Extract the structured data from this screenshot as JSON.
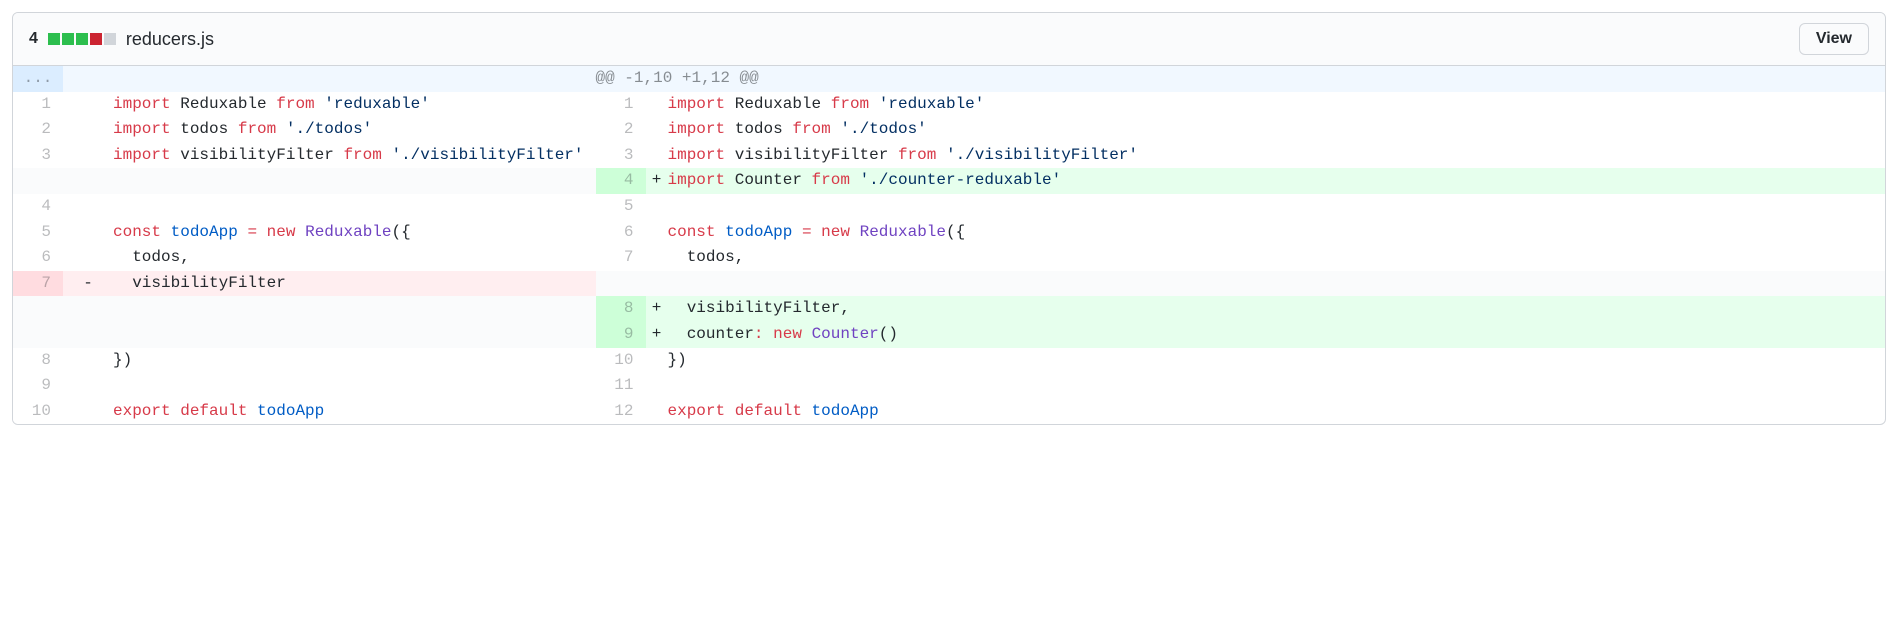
{
  "header": {
    "change_count": "4",
    "filename": "reducers.js",
    "view_label": "View",
    "diffstat": [
      "add",
      "add",
      "add",
      "del",
      "neutral"
    ]
  },
  "hunk": {
    "dots": "...",
    "text": "@@ -1,10 +1,12 @@"
  },
  "rows": [
    {
      "ln_l": "1",
      "ln_r": "1",
      "type": "ctx",
      "left": [
        {
          "t": "import",
          "c": "k"
        },
        {
          "t": " ",
          "c": ""
        },
        {
          "t": "Reduxable",
          "c": "nx"
        },
        {
          "t": " ",
          "c": ""
        },
        {
          "t": "from",
          "c": "k"
        },
        {
          "t": " ",
          "c": ""
        },
        {
          "t": "'reduxable'",
          "c": "s"
        }
      ],
      "right": [
        {
          "t": "import",
          "c": "k"
        },
        {
          "t": " ",
          "c": ""
        },
        {
          "t": "Reduxable",
          "c": "nx"
        },
        {
          "t": " ",
          "c": ""
        },
        {
          "t": "from",
          "c": "k"
        },
        {
          "t": " ",
          "c": ""
        },
        {
          "t": "'reduxable'",
          "c": "s"
        }
      ]
    },
    {
      "ln_l": "2",
      "ln_r": "2",
      "type": "ctx",
      "left": [
        {
          "t": "import",
          "c": "k"
        },
        {
          "t": " ",
          "c": ""
        },
        {
          "t": "todos",
          "c": "nx"
        },
        {
          "t": " ",
          "c": ""
        },
        {
          "t": "from",
          "c": "k"
        },
        {
          "t": " ",
          "c": ""
        },
        {
          "t": "'./todos'",
          "c": "s"
        }
      ],
      "right": [
        {
          "t": "import",
          "c": "k"
        },
        {
          "t": " ",
          "c": ""
        },
        {
          "t": "todos",
          "c": "nx"
        },
        {
          "t": " ",
          "c": ""
        },
        {
          "t": "from",
          "c": "k"
        },
        {
          "t": " ",
          "c": ""
        },
        {
          "t": "'./todos'",
          "c": "s"
        }
      ]
    },
    {
      "ln_l": "3",
      "ln_r": "3",
      "type": "ctx",
      "left": [
        {
          "t": "import",
          "c": "k"
        },
        {
          "t": " ",
          "c": ""
        },
        {
          "t": "visibilityFilter",
          "c": "nx"
        },
        {
          "t": " ",
          "c": ""
        },
        {
          "t": "from",
          "c": "k"
        },
        {
          "t": " ",
          "c": ""
        },
        {
          "t": "'./visibilityFilter'",
          "c": "s"
        }
      ],
      "right": [
        {
          "t": "import",
          "c": "k"
        },
        {
          "t": " ",
          "c": ""
        },
        {
          "t": "visibilityFilter",
          "c": "nx"
        },
        {
          "t": " ",
          "c": ""
        },
        {
          "t": "from",
          "c": "k"
        },
        {
          "t": " ",
          "c": ""
        },
        {
          "t": "'./visibilityFilter'",
          "c": "s"
        }
      ]
    },
    {
      "ln_l": "",
      "ln_r": "4",
      "type": "add",
      "right": [
        {
          "t": "import",
          "c": "k"
        },
        {
          "t": " ",
          "c": ""
        },
        {
          "t": "Counter",
          "c": "nx"
        },
        {
          "t": " ",
          "c": ""
        },
        {
          "t": "from",
          "c": "k"
        },
        {
          "t": " ",
          "c": ""
        },
        {
          "t": "'./counter-reduxable'",
          "c": "s"
        }
      ]
    },
    {
      "ln_l": "4",
      "ln_r": "5",
      "type": "ctx",
      "left": [
        {
          "t": "",
          "c": ""
        }
      ],
      "right": [
        {
          "t": "",
          "c": ""
        }
      ]
    },
    {
      "ln_l": "5",
      "ln_r": "6",
      "type": "ctx",
      "left": [
        {
          "t": "const",
          "c": "k"
        },
        {
          "t": " ",
          "c": ""
        },
        {
          "t": "todoApp",
          "c": "v"
        },
        {
          "t": " ",
          "c": ""
        },
        {
          "t": "=",
          "c": "o"
        },
        {
          "t": " ",
          "c": ""
        },
        {
          "t": "new",
          "c": "k"
        },
        {
          "t": " ",
          "c": ""
        },
        {
          "t": "Reduxable",
          "c": "fn"
        },
        {
          "t": "({",
          "c": ""
        }
      ],
      "right": [
        {
          "t": "const",
          "c": "k"
        },
        {
          "t": " ",
          "c": ""
        },
        {
          "t": "todoApp",
          "c": "v"
        },
        {
          "t": " ",
          "c": ""
        },
        {
          "t": "=",
          "c": "o"
        },
        {
          "t": " ",
          "c": ""
        },
        {
          "t": "new",
          "c": "k"
        },
        {
          "t": " ",
          "c": ""
        },
        {
          "t": "Reduxable",
          "c": "fn"
        },
        {
          "t": "({",
          "c": ""
        }
      ]
    },
    {
      "ln_l": "6",
      "ln_r": "7",
      "type": "ctx",
      "left": [
        {
          "t": "  todos,",
          "c": ""
        }
      ],
      "right": [
        {
          "t": "  todos,",
          "c": ""
        }
      ]
    },
    {
      "ln_l": "7",
      "ln_r": "",
      "type": "del",
      "left": [
        {
          "t": "  visibilityFilter",
          "c": ""
        }
      ]
    },
    {
      "ln_l": "",
      "ln_r": "8",
      "type": "add",
      "right": [
        {
          "t": "  visibilityFilter,",
          "c": ""
        }
      ]
    },
    {
      "ln_l": "",
      "ln_r": "9",
      "type": "add",
      "right": [
        {
          "t": "  counter",
          "c": ""
        },
        {
          "t": ":",
          "c": "o"
        },
        {
          "t": " ",
          "c": ""
        },
        {
          "t": "new",
          "c": "k"
        },
        {
          "t": " ",
          "c": ""
        },
        {
          "t": "Counter",
          "c": "fn"
        },
        {
          "t": "()",
          "c": ""
        }
      ]
    },
    {
      "ln_l": "8",
      "ln_r": "10",
      "type": "ctx",
      "left": [
        {
          "t": "})",
          "c": ""
        }
      ],
      "right": [
        {
          "t": "})",
          "c": ""
        }
      ]
    },
    {
      "ln_l": "9",
      "ln_r": "11",
      "type": "ctx",
      "left": [
        {
          "t": "",
          "c": ""
        }
      ],
      "right": [
        {
          "t": "",
          "c": ""
        }
      ]
    },
    {
      "ln_l": "10",
      "ln_r": "12",
      "type": "ctx",
      "left": [
        {
          "t": "export",
          "c": "k"
        },
        {
          "t": " ",
          "c": ""
        },
        {
          "t": "default",
          "c": "k"
        },
        {
          "t": " ",
          "c": ""
        },
        {
          "t": "todoApp",
          "c": "v"
        }
      ],
      "right": [
        {
          "t": "export",
          "c": "k"
        },
        {
          "t": " ",
          "c": ""
        },
        {
          "t": "default",
          "c": "k"
        },
        {
          "t": " ",
          "c": ""
        },
        {
          "t": "todoApp",
          "c": "v"
        }
      ]
    }
  ]
}
